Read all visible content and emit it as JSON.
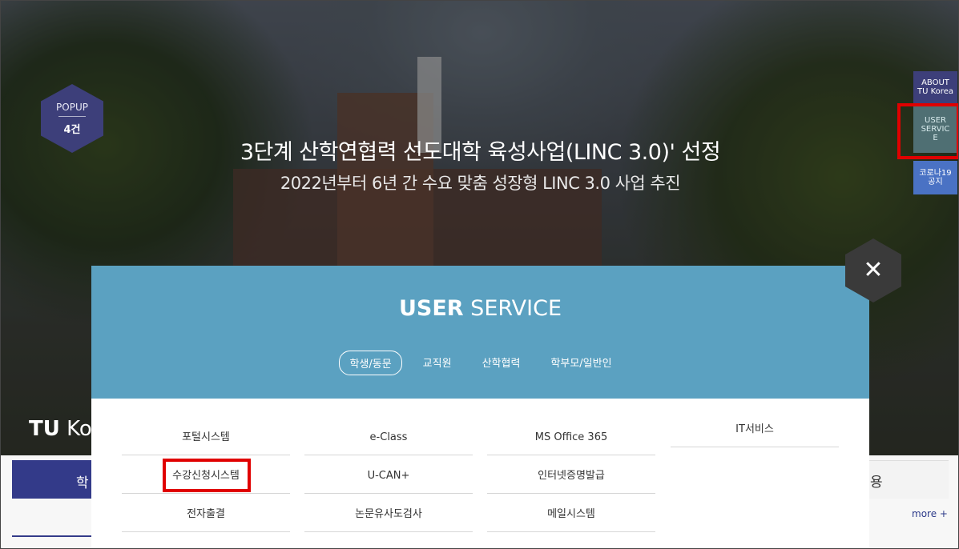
{
  "hero": {
    "title": "3단계 산학연협력 선도대학 육성사업(LINC 3.0)' 선정",
    "subtitle": "2022년부터 6년 간 수요 맞춤 성장형 LINC 3.0 사업 추진"
  },
  "popup": {
    "label": "POPUP",
    "count": "4건"
  },
  "side_menu": {
    "about": [
      "ABOUT",
      "TU Korea"
    ],
    "user_service": [
      "USER",
      "SERVIC",
      "E"
    ],
    "covid": [
      "코로나19",
      "공지"
    ]
  },
  "page": {
    "tu_title_bold": "TU",
    "tu_title_rest": " Ko",
    "left_tab": "학",
    "right_tab": "용",
    "more": "more +"
  },
  "modal": {
    "title_bold": "USER",
    "title_rest": " SERVICE",
    "tabs": [
      "학생/동문",
      "교직원",
      "산학협력",
      "학부모/일반인"
    ],
    "services": [
      "포털시스템",
      "e-Class",
      "MS Office 365",
      "IT서비스",
      "수강신청시스템",
      "U-CAN+",
      "인터넷증명발급",
      "전자출결",
      "논문유사도검사",
      "메일시스템"
    ],
    "close_symbol": "✕"
  },
  "colors": {
    "modal_header": "#5ba1c1",
    "navy": "#333a89",
    "highlight": "#e00000"
  },
  "icons": {
    "close": "close-icon"
  }
}
